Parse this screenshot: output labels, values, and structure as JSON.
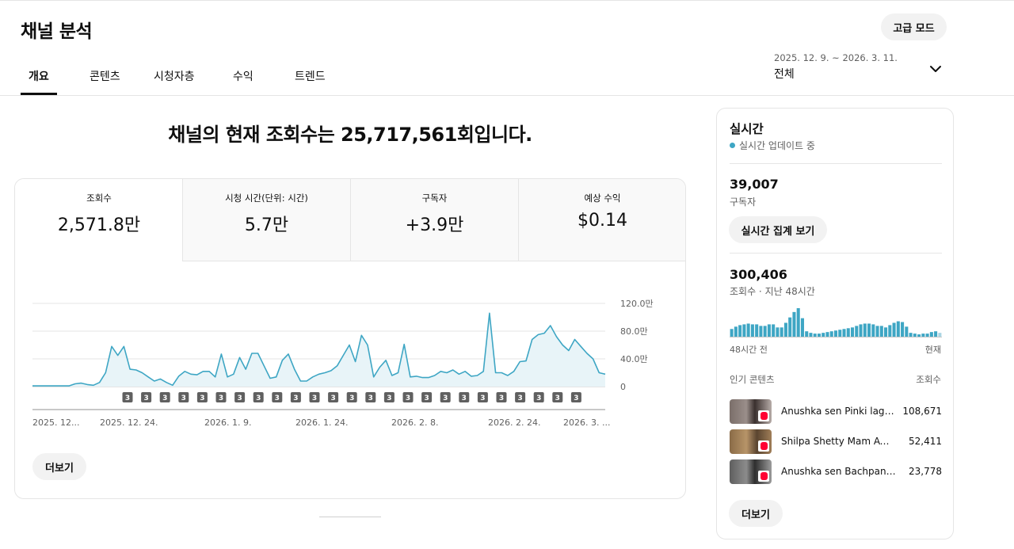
{
  "header": {
    "title": "채널 분석",
    "advanced_mode_label": "고급 모드",
    "date_range": "2025. 12. 9. ~ 2026. 3. 11.",
    "date_scope": "전체"
  },
  "tabs": [
    {
      "label": "개요",
      "active": true
    },
    {
      "label": "콘텐츠",
      "active": false
    },
    {
      "label": "시청자층",
      "active": false
    },
    {
      "label": "수익",
      "active": false
    },
    {
      "label": "트렌드",
      "active": false
    }
  ],
  "headline": "채널의 현재 조회수는 25,717,561회입니다.",
  "metrics": [
    {
      "label": "조회수",
      "value": "2,571.8만",
      "selected": true
    },
    {
      "label": "시청 시간(단위: 시간)",
      "value": "5.7만",
      "selected": false
    },
    {
      "label": "구독자",
      "value": "+3.9만",
      "selected": false
    },
    {
      "label": "예상 수익",
      "value": "$0.14",
      "selected": false
    }
  ],
  "more_label": "더보기",
  "colors": {
    "accent": "#3ea6c4",
    "area_fill": "#e8f4f8",
    "marker_bg": "#606060"
  },
  "chart_data": {
    "type": "area",
    "y_unit": "만",
    "ylim": [
      0,
      120
    ],
    "y_ticks": [
      "120.0만",
      "80.0만",
      "40.0만",
      "0"
    ],
    "x_tick_labels": [
      "2025. 12...",
      "2025. 12. 24.",
      "2026. 1. 9.",
      "2026. 1. 24.",
      "2026. 2. 8.",
      "2026. 2. 24.",
      "2026. 3. ..."
    ],
    "marker_label": "3",
    "marker_count": 25,
    "grid": true,
    "series": [
      {
        "values": [
          1,
          1,
          1,
          1,
          1,
          1,
          1,
          4,
          5,
          3,
          2,
          6,
          20,
          58,
          45,
          58,
          25,
          24,
          20,
          14,
          8,
          11,
          6,
          2,
          15,
          22,
          18,
          17,
          22,
          22,
          14,
          47,
          14,
          18,
          42,
          25,
          48,
          48,
          30,
          12,
          14,
          38,
          47,
          25,
          8,
          8,
          14,
          18,
          20,
          23,
          30,
          45,
          60,
          36,
          74,
          60,
          14,
          28,
          38,
          16,
          20,
          61,
          14,
          15,
          13,
          13,
          16,
          22,
          20,
          24,
          18,
          22,
          15,
          16,
          22,
          106,
          20,
          20,
          16,
          22,
          36,
          37,
          68,
          75,
          77,
          88,
          72,
          60,
          52,
          68,
          58,
          48,
          40,
          20,
          18
        ]
      }
    ]
  },
  "realtime": {
    "title": "실시간",
    "status": "실시간 업데이트 중",
    "subscribers_value": "39,007",
    "subscribers_label": "구독자",
    "live_count_button": "실시간 집계 보기",
    "views_value": "300,406",
    "views_label": "조회수 · 지난 48시간",
    "axis_left": "48시간 전",
    "axis_right": "현재",
    "hourly_views": [
      10,
      13,
      15,
      16,
      17,
      16,
      16,
      14,
      14,
      16,
      16,
      12,
      12,
      18,
      25,
      32,
      37,
      24,
      7,
      5,
      4,
      4,
      5,
      6,
      7,
      8,
      9,
      10,
      11,
      12,
      14,
      16,
      17,
      17,
      16,
      14,
      14,
      12,
      15,
      18,
      20,
      19,
      13,
      5,
      4,
      3,
      4,
      4,
      6,
      7,
      5
    ],
    "top_content_header": "인기 콘텐츠",
    "views_header": "조회수",
    "top_content": [
      {
        "title": "Anushka sen Pinki lag ...",
        "views": "108,671"
      },
      {
        "title": "Shilpa Shetty Mam Awa...",
        "views": "52,411"
      },
      {
        "title": "Anushka sen Bachpan s...",
        "views": "23,778"
      }
    ],
    "more_label": "더보기"
  }
}
